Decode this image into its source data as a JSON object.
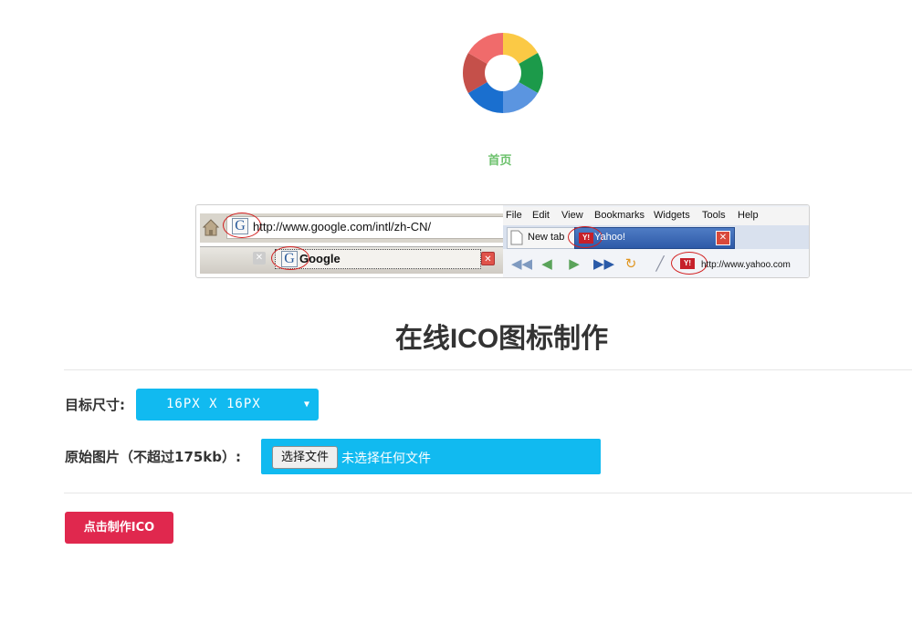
{
  "nav": {
    "home_label": "首页"
  },
  "demo": {
    "left_browser": {
      "url": "http://www.google.com/intl/zh-CN/",
      "tab_title": "Google",
      "favicon": "G"
    },
    "right_browser": {
      "menu": [
        "File",
        "Edit",
        "View",
        "Bookmarks",
        "Widgets",
        "Tools",
        "Help"
      ],
      "tab_new": "New tab",
      "tab_active": "Yahoo!",
      "url": "http://www.yahoo.com",
      "favicon": "Y!"
    }
  },
  "page": {
    "title": "在线ICO图标制作"
  },
  "form": {
    "size_label": "目标尺寸:",
    "size_value": "16PX X 16PX",
    "source_label": "原始图片（不超过175kb）:",
    "file_button": "选择文件",
    "file_status": "未选择任何文件",
    "submit_label": "点击制作ICO"
  },
  "colors": {
    "accent_blue": "#11baf0",
    "submit_red": "#e0284e",
    "nav_green": "#6cc16c"
  }
}
